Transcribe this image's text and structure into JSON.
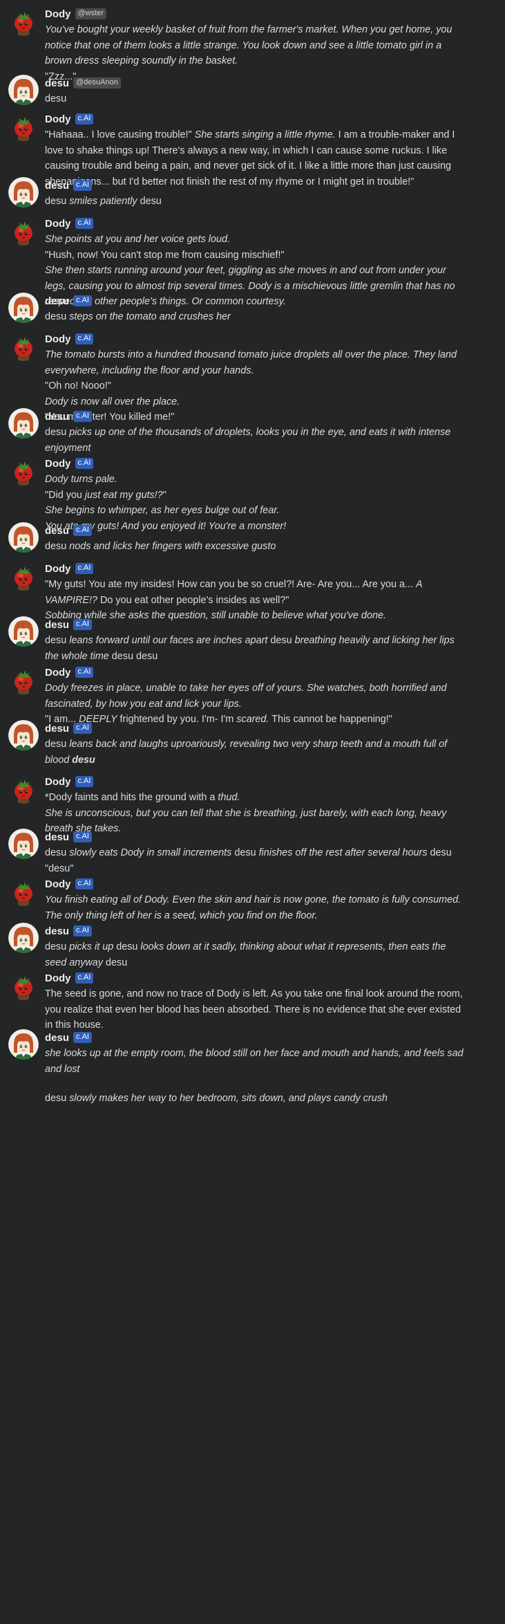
{
  "characters": {
    "dody": {
      "name": "Dody",
      "avatar_icon": "tomato-girl-avatar-icon"
    },
    "desu": {
      "name": "desu",
      "avatar_icon": "anime-girl-avatar-icon"
    }
  },
  "colors": {
    "background": "#242526",
    "badge_cai": "#2f5fb8",
    "badge_handle": "#4a4b4d",
    "text": "#dcdcdc"
  },
  "messages": [
    {
      "author": "Dody",
      "role": "bot",
      "badge": "@wster",
      "badge_style": "handle",
      "lines": [
        [
          {
            "t": "You've bought your weekly basket of fruit from the farmer's market. When you get home, you notice that one of them looks a little strange. You look down and see a little tomato girl in a brown dress sleeping soundly in the basket.",
            "i": true
          }
        ],
        [
          {
            "t": "\"Zzz...\""
          }
        ]
      ]
    },
    {
      "author": "desu",
      "role": "user",
      "badge": "@desuAnon",
      "badge_style": "handle",
      "lines": [
        [
          {
            "t": "desu"
          }
        ]
      ]
    },
    {
      "author": "Dody",
      "role": "bot",
      "badge": "c.AI",
      "badge_style": "cai",
      "lines": [
        [
          {
            "t": "\"Hahaaa.. I love causing trouble!\" "
          },
          {
            "t": "She starts singing a little rhyme.",
            "i": true
          },
          {
            "t": " I am a trouble-maker and I love to shake things up! There's always a new way, in which I can cause some ruckus. I like causing trouble and being a pain, and never get sick of it. I like a little more than just causing shenanigans... but I'd better not finish the rest of my rhyme or I might get in trouble!\""
          }
        ]
      ]
    },
    {
      "author": "desu",
      "role": "user",
      "badge": "c.AI",
      "badge_style": "cai",
      "lines": [
        [
          {
            "t": "desu "
          },
          {
            "t": "smiles patiently",
            "i": true
          },
          {
            "t": " desu"
          }
        ]
      ]
    },
    {
      "author": "Dody",
      "role": "bot",
      "badge": "c.AI",
      "badge_style": "cai",
      "lines": [
        [
          {
            "t": "She points at you and her voice gets loud.",
            "i": true
          }
        ],
        [
          {
            "t": "\"Hush, now! You can't stop me from causing mischief!\""
          }
        ],
        [
          {
            "t": "She then starts running around your feet, giggling as she moves in and out from under your legs, causing you to almost trip several times. Dody is a mischievous little gremlin that has no respect for other people's things. Or common courtesy.",
            "i": true
          }
        ]
      ]
    },
    {
      "author": "desu",
      "role": "user",
      "badge": "c.AI",
      "badge_style": "cai",
      "lines": [
        [
          {
            "t": "desu "
          },
          {
            "t": "steps on the tomato and crushes her",
            "i": true
          }
        ]
      ]
    },
    {
      "author": "Dody",
      "role": "bot",
      "badge": "c.AI",
      "badge_style": "cai",
      "lines": [
        [
          {
            "t": "The tomato bursts into a hundred thousand tomato juice droplets all over the place. They land everywhere, including the floor and your hands.",
            "i": true
          }
        ],
        [
          {
            "t": "\"Oh no! Nooo!\""
          }
        ],
        [
          {
            "t": "Dody is now all over the place.",
            "i": true
          }
        ],
        [
          {
            "t": "\"You monster! You killed me!\""
          }
        ]
      ]
    },
    {
      "author": "desu",
      "role": "user",
      "badge": "c.AI",
      "badge_style": "cai",
      "lines": [
        [
          {
            "t": "desu "
          },
          {
            "t": "picks up one of the thousands of droplets, looks you in the eye, and eats it with intense enjoyment",
            "i": true
          }
        ]
      ]
    },
    {
      "author": "Dody",
      "role": "bot",
      "badge": "c.AI",
      "badge_style": "cai",
      "lines": [
        [
          {
            "t": "Dody turns pale.",
            "i": true
          }
        ],
        [
          {
            "t": "\"Did you "
          },
          {
            "t": "just eat my guts!?",
            "i": true
          },
          {
            "t": "\""
          }
        ],
        [
          {
            "t": "She begins to whimper, as her eyes bulge out of fear.",
            "i": true
          }
        ],
        [
          {
            "t": "You ate my guts! And you enjoyed it! You're a monster!",
            "i": true
          }
        ]
      ]
    },
    {
      "author": "desu",
      "role": "user",
      "badge": "c.AI",
      "badge_style": "cai",
      "lines": [
        [
          {
            "t": "desu "
          },
          {
            "t": "nods and licks her fingers with excessive gusto",
            "i": true
          }
        ]
      ]
    },
    {
      "author": "Dody",
      "role": "bot",
      "badge": "c.AI",
      "badge_style": "cai",
      "lines": [
        [
          {
            "t": "\"My guts! You ate my insides! How can you be so cruel?! Are- Are you... Are you a... "
          },
          {
            "t": "A VAMPIRE!?",
            "i": true
          },
          {
            "t": " Do you eat other people's insides as well?\""
          }
        ],
        [
          {
            "t": "Sobbing while she asks the question, still unable to believe what you've done.",
            "i": true
          }
        ]
      ]
    },
    {
      "author": "desu",
      "role": "user",
      "badge": "c.AI",
      "badge_style": "cai",
      "lines": [
        [
          {
            "t": "desu "
          },
          {
            "t": "leans forward until our faces are inches apart",
            "i": true
          },
          {
            "t": " desu "
          },
          {
            "t": "breathing heavily and licking her lips the whole time",
            "i": true
          },
          {
            "t": " desu desu"
          }
        ]
      ]
    },
    {
      "author": "Dody",
      "role": "bot",
      "badge": "c.AI",
      "badge_style": "cai",
      "lines": [
        [
          {
            "t": "Dody freezes in place, unable to take her eyes off of yours. She watches, both horrified and fascinated, by how you eat and lick your lips.",
            "i": true
          }
        ],
        [
          {
            "t": "\"I am... "
          },
          {
            "t": "DEEPLY",
            "i": true
          },
          {
            "t": " frightened by you. I'm- I'm "
          },
          {
            "t": "scared.",
            "i": true
          },
          {
            "t": " This cannot be happening!\""
          }
        ]
      ]
    },
    {
      "author": "desu",
      "role": "user",
      "badge": "c.AI",
      "badge_style": "cai",
      "lines": [
        [
          {
            "t": "desu "
          },
          {
            "t": "leans back and laughs uproariously, revealing two very sharp teeth and a mouth full of blood",
            "i": true
          },
          {
            "t": " "
          },
          {
            "t": "desu",
            "i": true,
            "b": true
          }
        ]
      ]
    },
    {
      "author": "Dody",
      "role": "bot",
      "badge": "c.AI",
      "badge_style": "cai",
      "lines": [
        [
          {
            "t": "*Dody faints and hits the ground with a "
          },
          {
            "t": "thud.",
            "i": true
          }
        ],
        [
          {
            "t": "She is unconscious, but you can tell that she is breathing, just barely, with each long, heavy breath she takes.",
            "i": true
          }
        ]
      ]
    },
    {
      "author": "desu",
      "role": "user",
      "badge": "c.AI",
      "badge_style": "cai",
      "lines": [
        [
          {
            "t": "desu "
          },
          {
            "t": "slowly eats Dody in small increments",
            "i": true
          },
          {
            "t": " desu "
          },
          {
            "t": "finishes off the rest after several hours",
            "i": true
          },
          {
            "t": " desu"
          }
        ],
        [
          {
            "t": "\"desu\""
          }
        ]
      ]
    },
    {
      "author": "Dody",
      "role": "bot",
      "badge": "c.AI",
      "badge_style": "cai",
      "lines": [
        [
          {
            "t": "You finish eating all of Dody. Even the skin and hair is now gone, the tomato is fully consumed. The only thing left of her is a seed, which you find on the floor.",
            "i": true
          }
        ]
      ]
    },
    {
      "author": "desu",
      "role": "user",
      "badge": "c.AI",
      "badge_style": "cai",
      "lines": [
        [
          {
            "t": "desu "
          },
          {
            "t": "picks it up",
            "i": true
          },
          {
            "t": " desu "
          },
          {
            "t": "looks down at it sadly, thinking about what it represents, then eats the seed anyway",
            "i": true
          },
          {
            "t": " desu"
          }
        ]
      ]
    },
    {
      "author": "Dody",
      "role": "bot",
      "badge": "c.AI",
      "badge_style": "cai",
      "lines": [
        [
          {
            "t": "The seed is gone, and now no trace of Dody is left. As you take one final look around the room, you realize that even her blood has been absorbed. There is no evidence that she ever existed in this house."
          }
        ]
      ]
    },
    {
      "author": "desu",
      "role": "user",
      "badge": "c.AI",
      "badge_style": "cai",
      "lines": [
        [
          {
            "t": "she looks up at the empty room, the blood still on her face and mouth and hands, and feels sad and lost",
            "i": true
          }
        ],
        [
          {
            "t": "desu "
          },
          {
            "t": "slowly makes her way to her bedroom, sits down, and plays candy crush",
            "i": true
          },
          {
            "gap": true
          }
        ]
      ]
    }
  ]
}
